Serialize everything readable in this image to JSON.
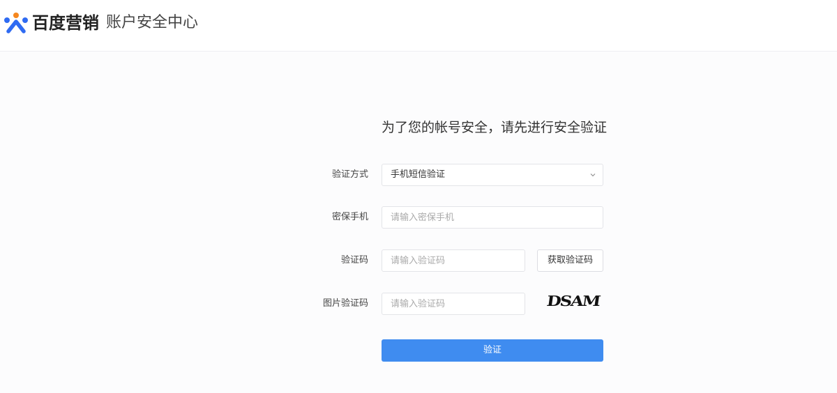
{
  "header": {
    "brand": "百度营销",
    "subtitle": "账户安全中心",
    "logo_icon": "baidu-marketing-logo-icon"
  },
  "form": {
    "title": "为了您的帐号安全，请先进行安全验证",
    "method": {
      "label": "验证方式",
      "value": "手机短信验证",
      "icon": "chevron-down-icon"
    },
    "phone": {
      "label": "密保手机",
      "placeholder": "请输入密保手机"
    },
    "code": {
      "label": "验证码",
      "placeholder": "请输入验证码",
      "button": "获取验证码"
    },
    "image_code": {
      "label": "图片验证码",
      "placeholder": "请输入验证码",
      "captcha_text": "DSAM"
    },
    "submit": "验证"
  },
  "colors": {
    "primary": "#3f8cf0",
    "logo_blue": "#2f6bf2",
    "logo_orange": "#f5871f",
    "border": "#e3e4e8",
    "background": "#fcfcfd"
  }
}
